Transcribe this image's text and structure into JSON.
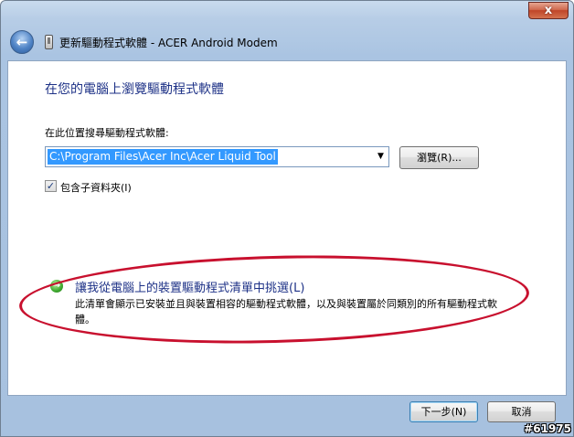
{
  "window": {
    "title": "更新驅動程式軟體 - ACER Android Modem",
    "close_label": "x"
  },
  "icons": {
    "back": "back-arrow-icon",
    "device": "device-icon",
    "close": "close-icon",
    "option_arrow": "green-arrow-icon",
    "checkbox_mark": "checkmark-icon"
  },
  "main": {
    "heading": "在您的電腦上瀏覽驅動程式軟體",
    "search_label": "在此位置搜尋驅動程式軟體:",
    "path_value": "C:\\Program Files\\Acer Inc\\Acer Liquid Tool",
    "browse_label": "瀏覽(R)...",
    "include_subfolders": {
      "label": "包含子資料夾(I)",
      "checked": true
    },
    "pick_option": {
      "title": "讓我從電腦上的裝置驅動程式清單中挑選(L)",
      "description": "此清單會顯示已安裝並且與裝置相容的驅動程式軟體，以及與裝置屬於同類別的所有驅動程式軟體。"
    }
  },
  "footer": {
    "next_label": "下一步(N)",
    "cancel_label": "取消"
  },
  "watermark": "#61975",
  "colors": {
    "heading": "#1e3287",
    "selection": "#3399ff",
    "annotation": "#c8102e"
  }
}
